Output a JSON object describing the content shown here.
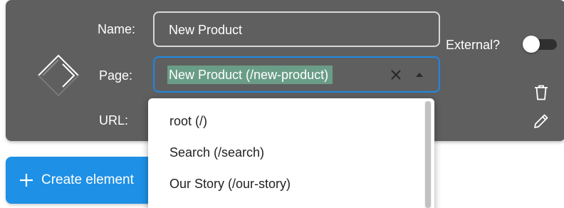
{
  "element_card": {
    "name_label": "Name:",
    "name_value": "New Product",
    "page_label": "Page:",
    "page_value": "New Product (/new-product)",
    "url_label": "URL:",
    "external_label": "External?",
    "external_on": false,
    "icons": {
      "drag": "drag-diamond-icon",
      "clear": "close-icon",
      "dropdown": "arrow-up-icon",
      "delete": "trash-icon",
      "edit": "pencil-icon"
    },
    "colors": {
      "card": "#5f5f5f",
      "focus": "#1e88e5",
      "selection": "#6a9d88"
    }
  },
  "page_dropdown": {
    "options": [
      "root (/)",
      "Search (/search)",
      "Our Story (/our-story)"
    ]
  },
  "create_button": {
    "label": "Create element",
    "icon": "plus-icon",
    "color": "#1e90e6"
  }
}
